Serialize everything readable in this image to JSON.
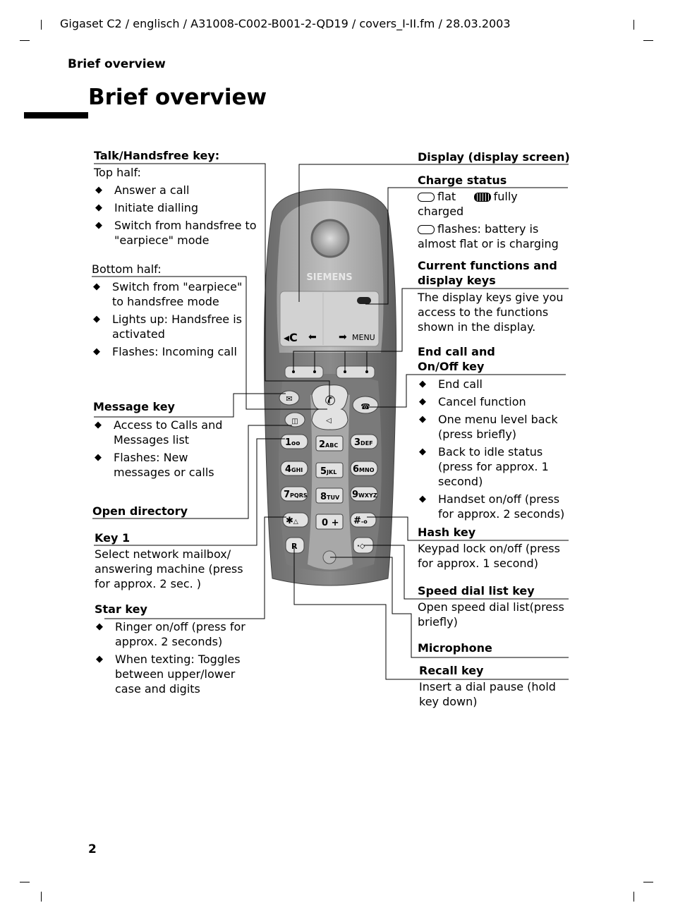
{
  "header": {
    "path": "Gigaset C2 / englisch / A31008-C002-B001-2-QD19 / covers_I-II.fm / 28.03.2003"
  },
  "running_head": "Brief overview",
  "page_title": "Brief overview",
  "page_number": "2",
  "phone": {
    "brand": "SIEMENS",
    "display_left_softkey": "C",
    "display_right_softkey": "MENU",
    "keys": [
      "1",
      "2ABC",
      "3DEF",
      "4GHI",
      "5JKL",
      "6MNO",
      "7PQRS",
      "8TUV",
      "9WXYZ",
      "*",
      "0+",
      "#",
      "R"
    ]
  },
  "left": {
    "talk": {
      "label": "Talk/Handsfree key:",
      "top_half": "Top half:",
      "top_items": [
        "Answer a call",
        "Initiate dialling",
        "Switch from handsfree to \"earpiece\" mode"
      ],
      "bottom_half": "Bottom half:",
      "bottom_items": [
        "Switch from \"earpiece\" to handsfree mode",
        "Lights up: Handsfree is activated",
        "Flashes: Incoming call"
      ]
    },
    "message": {
      "label": "Message key",
      "items": [
        "Access to Calls and Messages list",
        "Flashes: New messages or calls"
      ]
    },
    "directory": {
      "label": "Open directory"
    },
    "key1": {
      "label": "Key 1",
      "text": "Select network mailbox/ answering machine (press for approx. 2 sec. )"
    },
    "star": {
      "label": "Star key",
      "items": [
        "Ringer on/off (press for approx. 2 seconds)",
        "When texting: Toggles between upper/lower case and digits"
      ]
    }
  },
  "right": {
    "display": {
      "label": "Display (display screen)"
    },
    "charge": {
      "label": "Charge status",
      "flat": "flat",
      "fully": "fully",
      "charged": "charged",
      "flashes": "flashes: battery is almost flat or is charging"
    },
    "functions": {
      "label": "Current functions and display keys",
      "text": "The display keys give you access to the functions shown in the display."
    },
    "endcall": {
      "label": "End call and On/Off key",
      "items": [
        "End call",
        "Cancel function",
        "One menu level back (press briefly)",
        "Back to idle status (press for approx. 1 second)",
        "Handset on/off (press for approx. 2 seconds)"
      ]
    },
    "hash": {
      "label": "Hash key",
      "text": "Keypad lock on/off (press for approx. 1 second)"
    },
    "speed": {
      "label": "Speed dial list key",
      "text": "Open speed dial list(press briefly)"
    },
    "mic": {
      "label": "Microphone"
    },
    "recall": {
      "label": "Recall key",
      "text": "Insert a dial pause (hold key down)"
    }
  }
}
